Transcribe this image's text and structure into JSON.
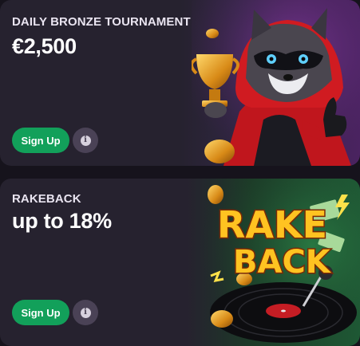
{
  "cards": [
    {
      "label": "DAILY BRONZE TOURNAMENT",
      "value": "€2,500",
      "signup_label": "Sign Up",
      "info_glyph": "i",
      "art_icon": "raccoon-trophy-illustration"
    },
    {
      "label": "RAKEBACK",
      "value": "up to 18%",
      "signup_label": "Sign Up",
      "info_glyph": "i",
      "art_icon": "rakeback-vinyl-illustration",
      "art_text_top": "RAKE",
      "art_text_bottom": "BACK"
    }
  ],
  "colors": {
    "card_bg": "#26222f",
    "signup_green": "#12a05a",
    "info_bg": "#4a4256",
    "rakeback_text": "#ffc321"
  }
}
